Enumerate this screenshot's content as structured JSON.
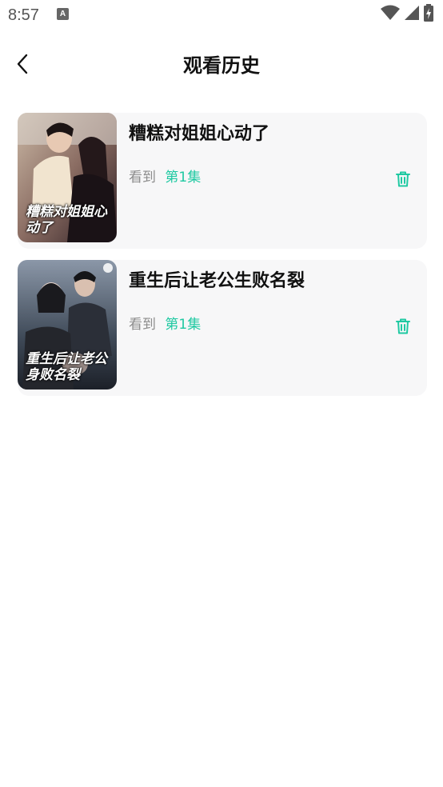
{
  "status_bar": {
    "time": "8:57",
    "notification_glyph": "A",
    "icons": [
      "wifi-icon",
      "signal-icon",
      "battery-icon"
    ]
  },
  "header": {
    "title": "观看历史",
    "back_icon": "chevron-left-icon"
  },
  "history": [
    {
      "title": "糟糕对姐姐心动了",
      "cover_text": "糟糕对姐姐心动了",
      "progress_prefix": "看到",
      "episode": "第1集"
    },
    {
      "title": "重生后让老公生败名裂",
      "cover_text": "重生后让老公身败名裂",
      "progress_prefix": "看到",
      "episode": "第1集"
    }
  ],
  "colors": {
    "accent": "#1fc9a2",
    "card_bg": "#f7f7f8",
    "muted_text": "#8c8c8c"
  }
}
